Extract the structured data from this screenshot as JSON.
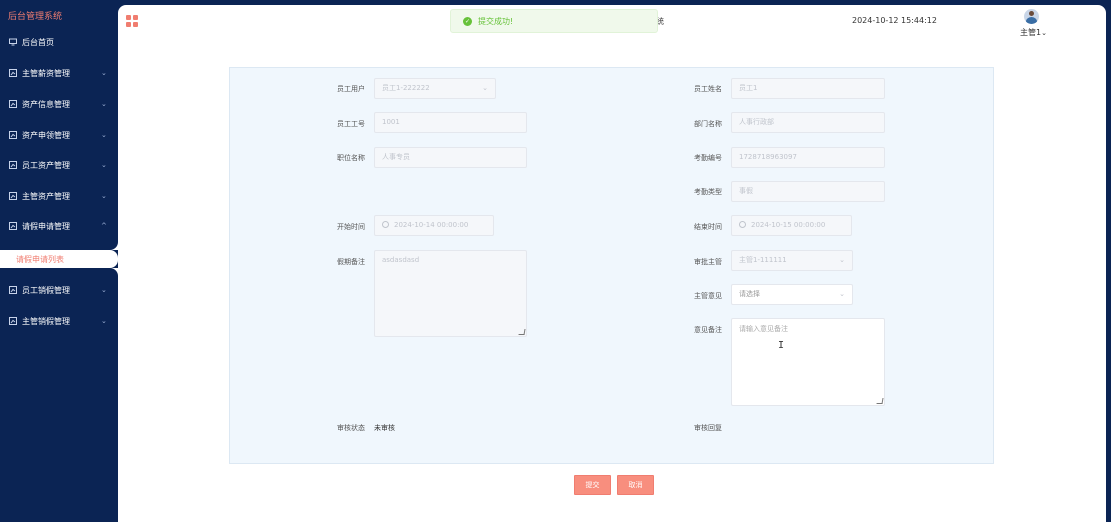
{
  "app": {
    "brand": "后台管理系统"
  },
  "sidebar": {
    "items": [
      {
        "label": "后台首页",
        "has_chevron": false
      },
      {
        "label": "主管薪资管理",
        "has_chevron": true,
        "chevron": "⌄"
      },
      {
        "label": "资产信息管理",
        "has_chevron": true,
        "chevron": "⌄"
      },
      {
        "label": "资产申领管理",
        "has_chevron": true,
        "chevron": "⌄"
      },
      {
        "label": "员工资产管理",
        "has_chevron": true,
        "chevron": "⌄"
      },
      {
        "label": "主管资产管理",
        "has_chevron": true,
        "chevron": "⌄"
      },
      {
        "label": "请假申请管理",
        "has_chevron": true,
        "chevron": "^"
      },
      {
        "label": "员工销假管理",
        "has_chevron": true,
        "chevron": "⌄"
      },
      {
        "label": "主管销假管理",
        "has_chevron": true,
        "chevron": "⌄"
      }
    ],
    "active_submenu": "请假申请列表"
  },
  "header": {
    "toast": "提交成功!",
    "toast_icon": "✓",
    "clipped_text": "统",
    "datetime": "2024-10-12 15:44:12",
    "user": "主管1",
    "user_chevron": "⌄"
  },
  "form": {
    "left": {
      "employee_user": {
        "label": "员工用户",
        "value": "员工1-222222"
      },
      "employee_no": {
        "label": "员工工号",
        "value": "1001"
      },
      "position": {
        "label": "职位名称",
        "value": "人事专员"
      },
      "start_time": {
        "label": "开始时间",
        "value": "2024-10-14 00:00:00"
      },
      "leave_note": {
        "label": "假期备注",
        "value": "asdasdasd"
      },
      "review_status": {
        "label": "审核状态",
        "value": "未审核"
      }
    },
    "right": {
      "employee_name": {
        "label": "员工姓名",
        "value": "员工1"
      },
      "department": {
        "label": "部门名称",
        "value": "人事行政部"
      },
      "attendance_no": {
        "label": "考勤编号",
        "value": "1728718963097"
      },
      "attendance_type": {
        "label": "考勤类型",
        "value": "事假"
      },
      "end_time": {
        "label": "结束时间",
        "value": "2024-10-15 00:00:00"
      },
      "approver": {
        "label": "审批主管",
        "value": "主管1-111111"
      },
      "opinion": {
        "label": "主管意见",
        "placeholder": "请选择"
      },
      "opinion_note": {
        "label": "意见备注",
        "placeholder": "请输入意见备注"
      },
      "review_reply": {
        "label": "审核回复",
        "value": ""
      }
    }
  },
  "buttons": {
    "submit": "提交",
    "cancel": "取消"
  },
  "colors": {
    "sidebar_bg": "#0b2454",
    "accent": "#f07d70",
    "button": "#f88e7e",
    "success": "#67c23a",
    "panel_bg": "#f0f7fd"
  }
}
